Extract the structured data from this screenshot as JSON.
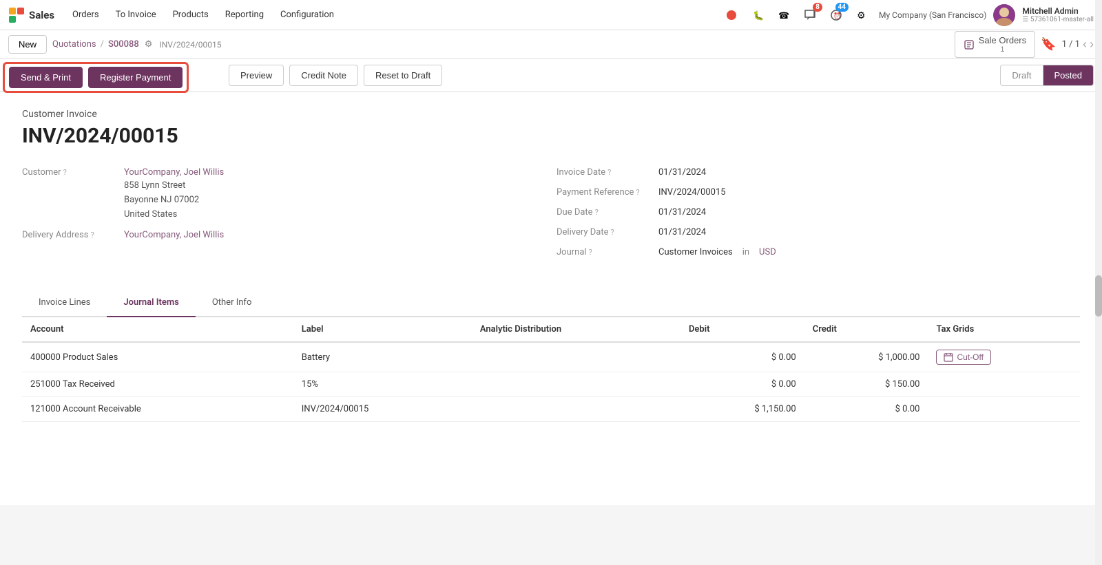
{
  "app": {
    "logo_text": "Sales",
    "nav_items": [
      "Orders",
      "To Invoice",
      "Products",
      "Reporting",
      "Configuration"
    ]
  },
  "header": {
    "new_label": "New",
    "breadcrumb": {
      "parent": "Quotations",
      "separator": "/",
      "current": "S00088",
      "sub": "INV/2024/00015"
    },
    "sale_orders_btn": "Sale Orders",
    "sale_orders_count": "1",
    "pagination": "1 / 1"
  },
  "actions": {
    "send_print": "Send & Print",
    "register_payment": "Register Payment",
    "preview": "Preview",
    "credit_note": "Credit Note",
    "reset_to_draft": "Reset to Draft",
    "status_draft": "Draft",
    "status_posted": "Posted"
  },
  "document": {
    "doc_type": "Customer Invoice",
    "doc_number": "INV/2024/00015",
    "customer_label": "Customer",
    "customer_name": "YourCompany, Joel Willis",
    "customer_address": "858 Lynn Street\nBayonne NJ 07002\nUnited States",
    "delivery_address_label": "Delivery Address",
    "delivery_address": "YourCompany, Joel Willis",
    "invoice_date_label": "Invoice Date",
    "invoice_date": "01/31/2024",
    "payment_ref_label": "Payment Reference",
    "payment_ref": "INV/2024/00015",
    "due_date_label": "Due Date",
    "due_date": "01/31/2024",
    "delivery_date_label": "Delivery Date",
    "delivery_date": "01/31/2024",
    "journal_label": "Journal",
    "journal": "Customer Invoices",
    "journal_in": "in",
    "currency": "USD"
  },
  "tabs": [
    {
      "id": "invoice-lines",
      "label": "Invoice Lines"
    },
    {
      "id": "journal-items",
      "label": "Journal Items"
    },
    {
      "id": "other-info",
      "label": "Other Info"
    }
  ],
  "table": {
    "headers": [
      "Account",
      "Label",
      "Analytic Distribution",
      "Debit",
      "Credit",
      "Tax Grids"
    ],
    "rows": [
      {
        "account": "400000 Product Sales",
        "label": "Battery",
        "analytic": "",
        "debit": "$ 0.00",
        "credit": "$ 1,000.00",
        "tax_grids": "Cut-Off",
        "has_cutoff": true
      },
      {
        "account": "251000 Tax Received",
        "label": "15%",
        "analytic": "",
        "debit": "$ 0.00",
        "credit": "$ 150.00",
        "tax_grids": "",
        "has_cutoff": false
      },
      {
        "account": "121000 Account Receivable",
        "label": "INV/2024/00015",
        "analytic": "",
        "debit": "$ 1,150.00",
        "credit": "$ 0.00",
        "tax_grids": "",
        "has_cutoff": false
      }
    ]
  }
}
